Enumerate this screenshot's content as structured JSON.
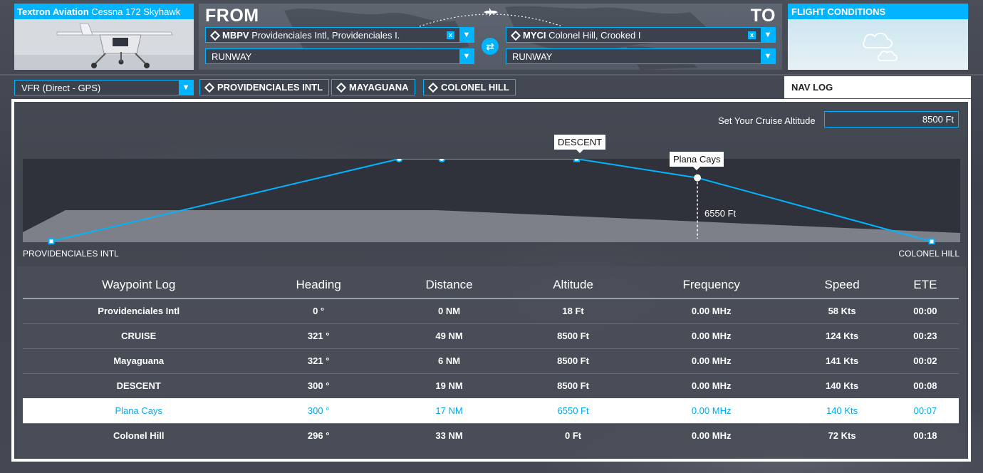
{
  "aircraft": {
    "brand": "Textron Aviation",
    "model": "Cessna 172 Skyhawk"
  },
  "route": {
    "from_label": "FROM",
    "to_label": "TO",
    "from": {
      "code": "MBPV",
      "name": "Providenciales Intl, Providenciales I.",
      "runway": "RUNWAY"
    },
    "to": {
      "code": "MYCI",
      "name": "Colonel Hill, Crooked I",
      "runway": "RUNWAY"
    },
    "clear_glyph": "x",
    "dropdown_glyph": "▼",
    "swap_glyph": "⇄"
  },
  "conditions": {
    "title": "FLIGHT CONDITIONS"
  },
  "flight_type": {
    "value": "VFR (Direct - GPS)"
  },
  "waypoint_chips": [
    "PROVIDENCIALES INTL",
    "MAYAGUANA",
    "COLONEL HILL"
  ],
  "tabs": {
    "navlog": "NAV LOG"
  },
  "cruise": {
    "label": "Set Your Cruise Altitude",
    "value": "8500 Ft"
  },
  "profile": {
    "start_label": "PROVIDENCIALES INTL",
    "end_label": "COLONEL HILL",
    "descent_tooltip": "DESCENT",
    "hover_tooltip": "Plana Cays",
    "hover_altitude": "6550 Ft",
    "max_altitude_ft": 8500
  },
  "chart_data": {
    "type": "line",
    "title": "",
    "xlabel": "",
    "ylabel": "",
    "x_cumulative_nm": [
      0,
      49,
      55,
      74,
      91,
      124
    ],
    "altitude_ft": [
      18,
      8500,
      8500,
      8500,
      6550,
      0
    ],
    "point_labels": [
      "Providencial Intl",
      "CRUISE",
      "Mayaguana",
      "DESCENT",
      "Plana Cays",
      "Colonel Hill"
    ]
  },
  "log": {
    "headers": [
      "Waypoint Log",
      "Heading",
      "Distance",
      "Altitude",
      "Frequency",
      "Speed",
      "ETE"
    ],
    "rows": [
      [
        "Providenciales Intl",
        "0 °",
        "0 NM",
        "18 Ft",
        "0.00 MHz",
        "58 Kts",
        "00:00"
      ],
      [
        "CRUISE",
        "321 °",
        "49 NM",
        "8500 Ft",
        "0.00 MHz",
        "124 Kts",
        "00:23"
      ],
      [
        "Mayaguana",
        "321 °",
        "6 NM",
        "8500 Ft",
        "0.00 MHz",
        "141 Kts",
        "00:02"
      ],
      [
        "DESCENT",
        "300 °",
        "19 NM",
        "8500 Ft",
        "0.00 MHz",
        "140 Kts",
        "00:08"
      ],
      [
        "Plana Cays",
        "300 °",
        "17 NM",
        "6550 Ft",
        "0.00 MHz",
        "140 Kts",
        "00:07"
      ],
      [
        "Colonel Hill",
        "296 °",
        "33 NM",
        "0 Ft",
        "0.00 MHz",
        "72 Kts",
        "00:18"
      ]
    ],
    "selected_row": 4
  },
  "colors": {
    "accent": "#00b4ff",
    "panel": "#3b414d",
    "selected_text": "#00a9f0"
  }
}
